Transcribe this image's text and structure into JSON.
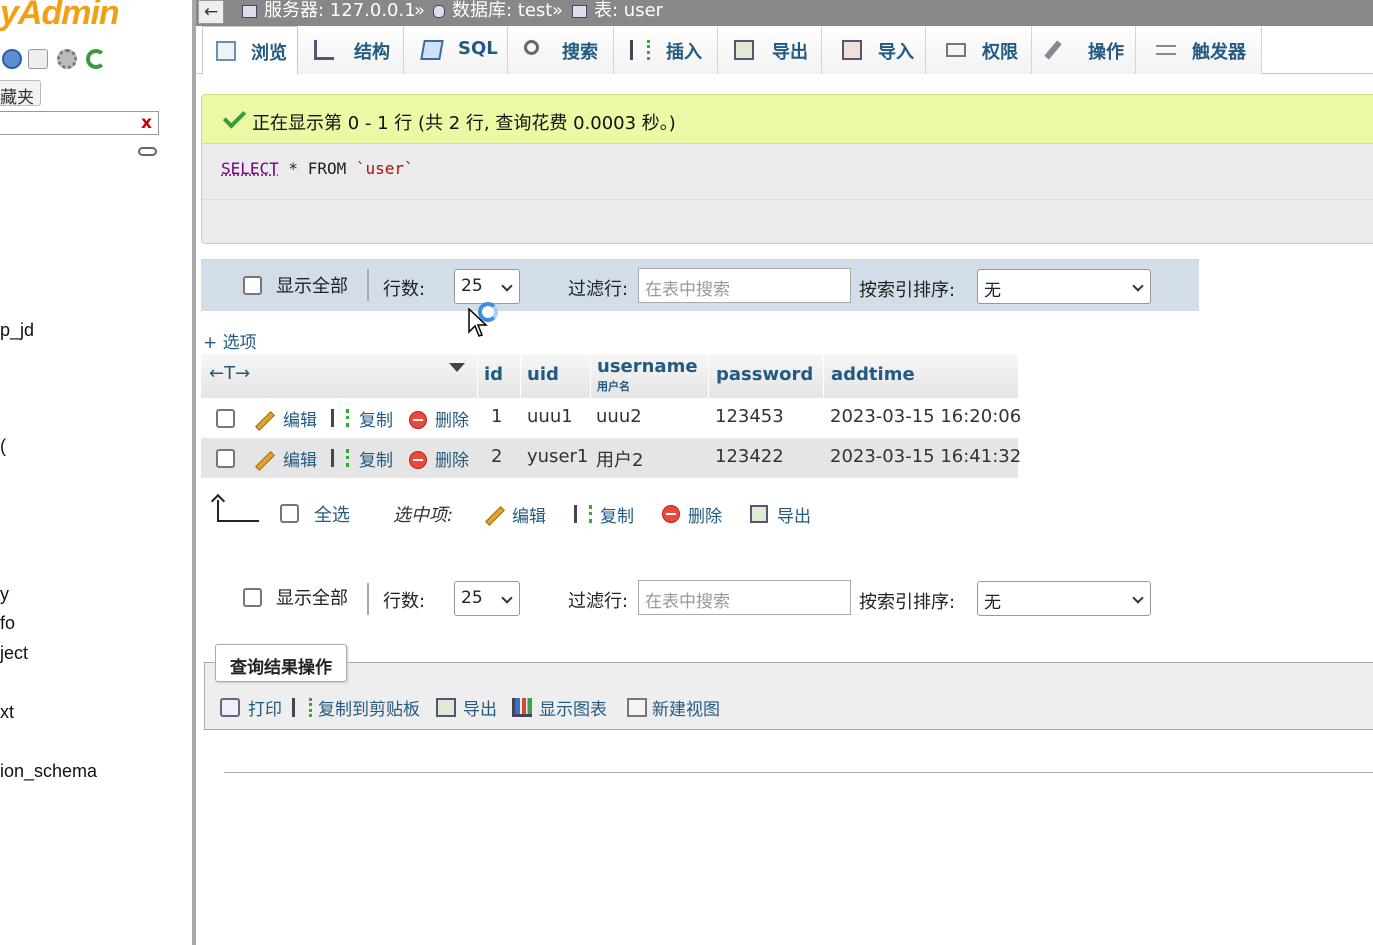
{
  "sidebar": {
    "logo": "yAdmin",
    "favorites_label": "藏夹",
    "filter_clear": "x",
    "databases": [
      "p_jd",
      "y",
      "fo",
      "ject",
      "xt",
      "ion_schema"
    ],
    "paren": "("
  },
  "breadcrumb": {
    "back": "←",
    "server": "服务器: 127.0.0.1",
    "sep1": "»",
    "database": "数据库: test",
    "sep2": "»",
    "table": "表: user"
  },
  "tabs": [
    {
      "label": "浏览",
      "icon": "browse-icon"
    },
    {
      "label": "结构",
      "icon": "structure-icon"
    },
    {
      "label": "SQL",
      "icon": "sql-icon"
    },
    {
      "label": "搜索",
      "icon": "search-icon"
    },
    {
      "label": "插入",
      "icon": "insert-icon"
    },
    {
      "label": "导出",
      "icon": "export-icon"
    },
    {
      "label": "导入",
      "icon": "import-icon"
    },
    {
      "label": "权限",
      "icon": "privileges-icon"
    },
    {
      "label": "操作",
      "icon": "operations-icon"
    },
    {
      "label": "触发器",
      "icon": "triggers-icon"
    }
  ],
  "message": {
    "text": "正在显示第 0 - 1 行 (共 2 行, 查询花费 0.0003 秒。)",
    "sql_keyword1": "SELECT",
    "sql_star": " * ",
    "sql_keyword2": "FROM",
    "sql_table": " `user`"
  },
  "nav_top": {
    "show_all": "显示全部",
    "rows_label": "行数:",
    "rows_value": "25",
    "filter_label": "过滤行:",
    "filter_placeholder": "在表中搜索",
    "sort_label": "按索引排序:",
    "sort_value": "无"
  },
  "nav_bottom": {
    "show_all": "显示全部",
    "rows_label": "行数:",
    "rows_value": "25",
    "filter_label": "过滤行:",
    "filter_placeholder": "在表中搜索",
    "sort_label": "按索引排序:",
    "sort_value": "无"
  },
  "options_link": "+ 选项",
  "table": {
    "resize_arrows": "←T→",
    "columns": [
      {
        "label": "id"
      },
      {
        "label": "uid"
      },
      {
        "label": "username",
        "sub": "用户名"
      },
      {
        "label": "password"
      },
      {
        "label": "addtime"
      }
    ],
    "actions": {
      "edit": "编辑",
      "copy": "复制",
      "delete": "删除"
    },
    "rows": [
      {
        "id": "1",
        "uid": "uuu1",
        "username": "uuu2",
        "password": "123453",
        "addtime": "2023-03-15 16:20:06"
      },
      {
        "id": "2",
        "uid": "yuser1",
        "username": "用户2",
        "password": "123422",
        "addtime": "2023-03-15 16:41:32"
      }
    ]
  },
  "bulk": {
    "select_all": "全选",
    "with_selected": "选中项:",
    "edit": "编辑",
    "copy": "复制",
    "delete": "删除",
    "export": "导出"
  },
  "query_ops": {
    "legend": "查询结果操作",
    "print": "打印",
    "copy_clipboard": "复制到剪贴板",
    "export": "导出",
    "chart": "显示图表",
    "create_view": "新建视图"
  },
  "colors": {
    "link": "#235a81",
    "success_bg": "#ebf8a4",
    "logo": "#f0a012"
  }
}
